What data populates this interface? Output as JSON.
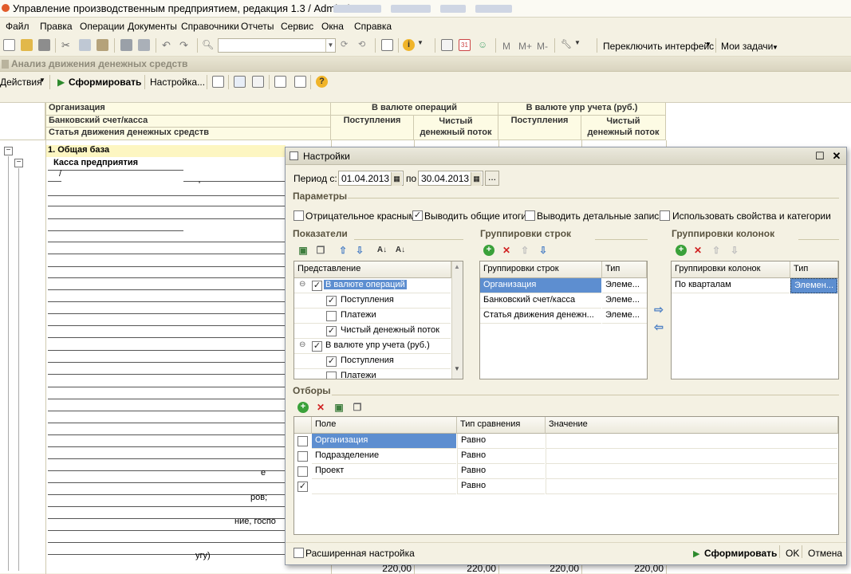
{
  "window": {
    "title": "Управление производственным предприятием, редакция 1.3 / Admin /"
  },
  "menu": [
    "Файл",
    "Правка",
    "Операции",
    "Документы",
    "Справочники",
    "Отчеты",
    "Сервис",
    "Окна",
    "Справка"
  ],
  "toolbar": {
    "switch_interface": "Переключить интерфейс",
    "my_tasks": "Мои задачи",
    "m": "M",
    "m_plus": "M+",
    "m_minus": "M-"
  },
  "form": {
    "title": "Анализ движения денежных средств",
    "actions": "Действия",
    "generate": "Сформировать",
    "settings": "Настройка..."
  },
  "report": {
    "header_rows": [
      "Организация",
      "Банковский счет/касса",
      "Статья движения денежных средств"
    ],
    "currency_ops": "В валюте операций",
    "currency_mgmt": "В валюте упр учета (руб.)",
    "receipts": "Поступления",
    "net_flow": "Чистый денежный поток",
    "group_1": "1. Общая база",
    "group_2": "Касса предприятия",
    "frag_1": "е",
    "frag_2": "ров;",
    "frag_3": "ние, госпо",
    "frag_4": "угу)",
    "frag_5": "/",
    "frag_6": "'",
    "totals": [
      "220,00",
      "220,00",
      "220,00",
      "220,00"
    ]
  },
  "dialog": {
    "title": "Настройки",
    "period_from_label": "Период с:",
    "period_from": "01.04.2013",
    "period_to_label": "по",
    "period_to": "30.04.2013",
    "more_btn": "...",
    "params_title": "Параметры",
    "params": [
      {
        "label": "Отрицательное красным",
        "checked": false
      },
      {
        "label": "Выводить общие итоги",
        "checked": true
      },
      {
        "label": "Выводить детальные записи",
        "checked": false
      },
      {
        "label": "Использовать свойства и категории",
        "checked": false
      }
    ],
    "indicators_title": "Показатели",
    "indicators_header": "Представление",
    "indicators": [
      {
        "label": "В валюте операций",
        "level": 0,
        "checked": true,
        "selected": true
      },
      {
        "label": "Поступления",
        "level": 1,
        "checked": true
      },
      {
        "label": "Платежи",
        "level": 1,
        "checked": false
      },
      {
        "label": "Чистый денежный поток",
        "level": 1,
        "checked": true
      },
      {
        "label": "В валюте упр учета (руб.)",
        "level": 0,
        "checked": true
      },
      {
        "label": "Поступления",
        "level": 1,
        "checked": true
      },
      {
        "label": "Платежи",
        "level": 1,
        "checked": false
      }
    ],
    "row_groups_title": "Группировки строк",
    "row_groups_header": [
      "Группировки строк",
      "Тип"
    ],
    "row_groups": [
      {
        "name": "Организация",
        "type": "Элеме..."
      },
      {
        "name": "Банковский счет/касса",
        "type": "Элеме..."
      },
      {
        "name": "Статья движения денежн...",
        "type": "Элеме..."
      }
    ],
    "col_groups_title": "Группировки колонок",
    "col_groups_header": [
      "Группировки колонок",
      "Тип"
    ],
    "col_groups": [
      {
        "name": "По кварталам",
        "type": "Элемен..."
      }
    ],
    "filters_title": "Отборы",
    "filters_header": [
      "Поле",
      "Тип сравнения",
      "Значение"
    ],
    "filters": [
      {
        "field": "Организация",
        "cmp": "Равно",
        "value": "",
        "checked": false
      },
      {
        "field": "Подразделение",
        "cmp": "Равно",
        "value": "",
        "checked": false
      },
      {
        "field": "Проект",
        "cmp": "Равно",
        "value": "",
        "checked": false
      },
      {
        "field": "",
        "cmp": "Равно",
        "value": "",
        "checked": true
      }
    ],
    "advanced": "Расширенная настройка",
    "generate": "Сформировать",
    "ok": "OK",
    "cancel": "Отмена"
  }
}
